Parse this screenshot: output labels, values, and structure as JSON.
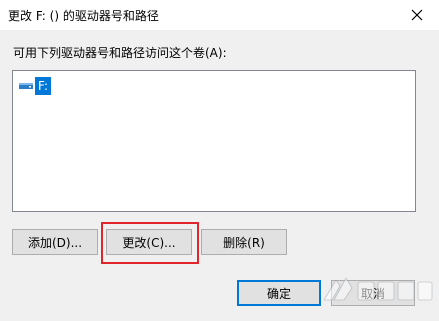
{
  "window": {
    "title": "更改 F: () 的驱动器号和路径",
    "close_icon": "close-icon"
  },
  "description": "可用下列驱动器号和路径访问这个卷(A):",
  "listbox": {
    "items": [
      {
        "label": "F:",
        "icon": "drive-icon",
        "selected": true
      }
    ]
  },
  "buttons": {
    "add": "添加(D)...",
    "change": "更改(C)...",
    "delete": "删除(R)",
    "ok": "确定",
    "cancel": "取消"
  },
  "colors": {
    "selection": "#0078d7",
    "highlight_box": "#e0262a"
  }
}
